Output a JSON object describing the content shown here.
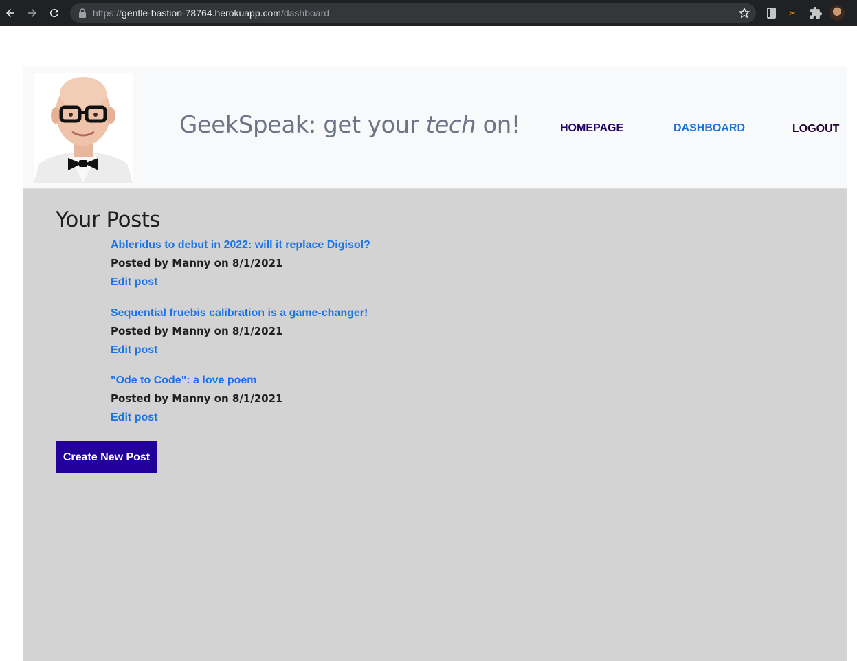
{
  "browser": {
    "url_scheme": "https://",
    "url_host": "gentle-bastion-78764.herokuapp.com",
    "url_path": "/dashboard"
  },
  "header": {
    "title_prefix": "GeekSpeak: get your ",
    "title_emphasis": "tech",
    "title_suffix": " on!",
    "nav": {
      "homepage": "HOMEPAGE",
      "dashboard": "DASHBOARD",
      "logout": "LOGOUT"
    }
  },
  "main": {
    "heading": "Your Posts",
    "posts": [
      {
        "title": "Ableridus to debut in 2022: will it replace Digisol?",
        "meta": "Posted by Manny on 8/1/2021",
        "edit": "Edit post"
      },
      {
        "title": "Sequential fruebis calibration is a game-changer!",
        "meta": "Posted by Manny on 8/1/2021",
        "edit": "Edit post"
      },
      {
        "title": "\"Ode to Code\": a love poem",
        "meta": "Posted by Manny on 8/1/2021",
        "edit": "Edit post"
      }
    ],
    "create_button": "Create New Post"
  },
  "colors": {
    "header_bg": "#f8f9fa",
    "main_bg": "#d3d3d3",
    "link_blue": "#1a73e8",
    "button_bg": "#220099",
    "nav_dark": "#220066"
  }
}
